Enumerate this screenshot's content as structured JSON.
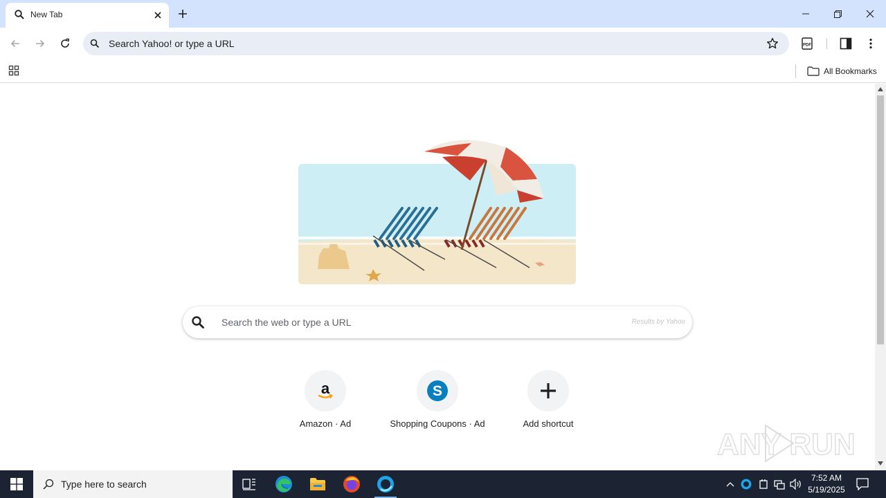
{
  "browser": {
    "tab": {
      "title": "New Tab"
    },
    "omnibox": {
      "placeholder": "Search Yahoo! or type a URL"
    },
    "bookmarks": {
      "all_bookmarks_label": "All Bookmarks"
    }
  },
  "newtab": {
    "search": {
      "placeholder": "Search the web or type a URL",
      "results_by": "Results by Yahoo"
    },
    "shortcuts": [
      {
        "label": "Amazon · Ad",
        "icon": "amazon-icon"
      },
      {
        "label": "Shopping Coupons · Ad",
        "icon": "shopping-coupons-icon"
      },
      {
        "label": "Add shortcut",
        "icon": "plus-icon"
      }
    ],
    "watermark": "ANY RUN"
  },
  "taskbar": {
    "search_placeholder": "Type here to search",
    "clock": {
      "time": "7:52 AM",
      "date": "5/19/2025"
    }
  },
  "colors": {
    "tab_strip": "#d3e3fd",
    "omnibox": "#e9eef6",
    "taskbar": "#1c2433",
    "accent": "#0b57d0"
  }
}
